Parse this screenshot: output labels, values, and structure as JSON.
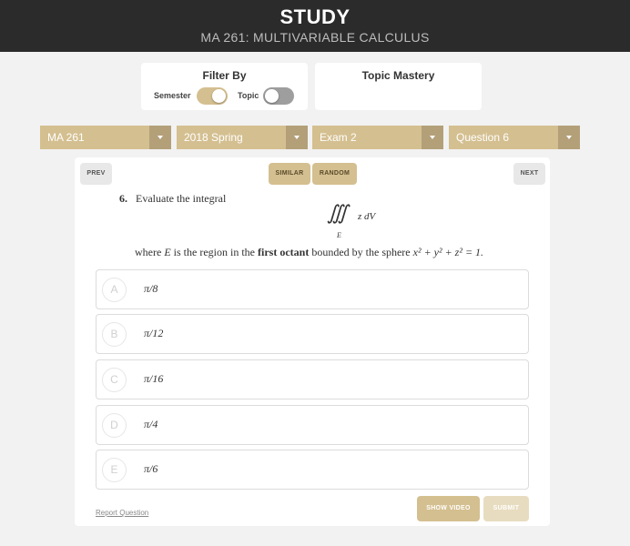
{
  "header": {
    "title": "STUDY",
    "subtitle": "MA 261: MULTIVARIABLE CALCULUS"
  },
  "filter": {
    "title": "Filter By",
    "semester_label": "Semester",
    "semester_on": true,
    "topic_label": "Topic",
    "topic_on": false
  },
  "mastery": {
    "title": "Topic Mastery"
  },
  "selects": {
    "course": "MA 261",
    "semester": "2018 Spring",
    "exam": "Exam 2",
    "question": "Question 6"
  },
  "nav": {
    "prev": "PREV",
    "similar": "SIMILAR",
    "random": "RANDOM",
    "next": "NEXT"
  },
  "question": {
    "number": "6.",
    "intro": "Evaluate the integral",
    "integral_symbol": "∭",
    "integrand": "z dV",
    "region_sub": "E",
    "line2_pre": "where ",
    "line2_var": "E",
    "line2_mid": " is the region in the ",
    "line2_bold": "first octant",
    "line2_post": " bounded by the sphere ",
    "line2_eq": "x² + y² + z² = 1."
  },
  "choices": [
    {
      "letter": "A",
      "answer": "π/8"
    },
    {
      "letter": "B",
      "answer": "π/12"
    },
    {
      "letter": "C",
      "answer": "π/16"
    },
    {
      "letter": "D",
      "answer": "π/4"
    },
    {
      "letter": "E",
      "answer": "π/6"
    }
  ],
  "footer": {
    "report": "Report Question",
    "show_video": "SHOW VIDEO",
    "submit": "SUBMIT"
  },
  "colors": {
    "header_bg": "#2b2b2b",
    "accent_gold": "#d4bf90",
    "accent_gold_dark": "#b3a079",
    "page_bg": "#f2f2f2"
  },
  "icons": {
    "select_arrow": "chevron-down-icon"
  }
}
